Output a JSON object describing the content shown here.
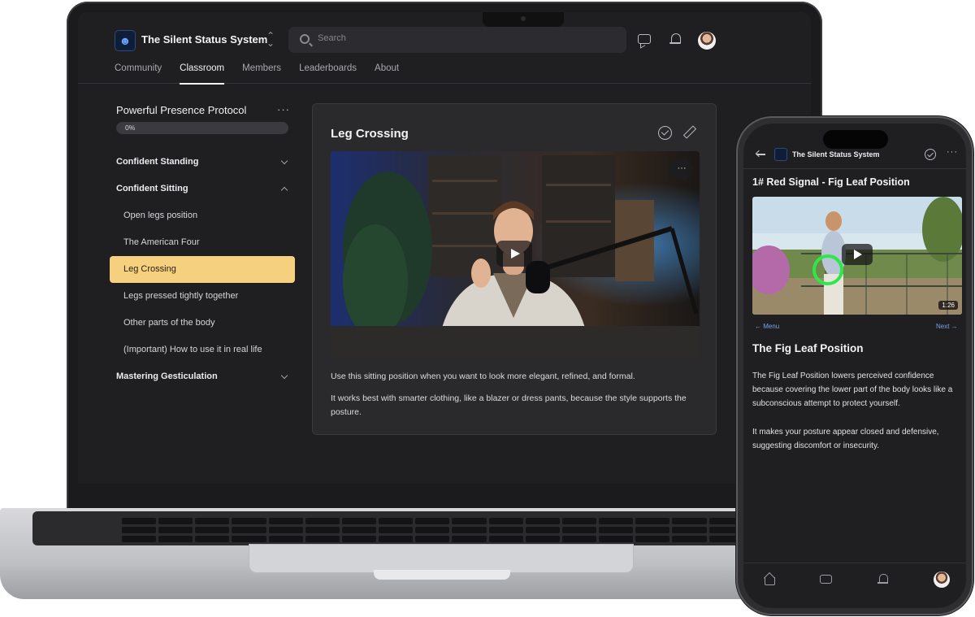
{
  "desktop": {
    "brand": {
      "name": "The Silent Status System"
    },
    "search": {
      "placeholder": "Search"
    },
    "nav_tabs": [
      "Community",
      "Classroom",
      "Members",
      "Leaderboards",
      "About"
    ],
    "active_tab": "Classroom",
    "course": {
      "title": "Powerful Presence Protocol",
      "menu": "···",
      "progress_label": "0%",
      "progress_fraction": 0.0
    },
    "sidebar": {
      "modules": [
        {
          "title": "Confident Standing",
          "expanded": false,
          "lessons": []
        },
        {
          "title": "Confident Sitting",
          "expanded": true,
          "lessons": [
            "Open legs position",
            "The American Four",
            "Leg Crossing",
            "Legs pressed tightly together",
            "Other parts of the body",
            "(Important) How to use it in real life"
          ]
        },
        {
          "title": "Mastering Gesticulation",
          "expanded": false,
          "lessons": []
        }
      ],
      "active_lesson": "Leg Crossing"
    },
    "lesson": {
      "title": "Leg Crossing",
      "video_menu": "···",
      "paragraphs": [
        "Use this sitting position when you want to look more elegant, refined, and formal.",
        "It works best with smarter clothing, like a blazer or dress pants, because the style supports the posture."
      ]
    }
  },
  "phone": {
    "brand": "The Silent Status System",
    "more": "···",
    "lesson_title": "1# Red Signal - Fig Leaf Position",
    "video_duration": "1:26",
    "nav_prev": "← Menu",
    "nav_next": "Next →",
    "heading": "The Fig Leaf Position",
    "paragraphs": [
      "The Fig Leaf Position lowers perceived confidence because covering the lower part of the body looks like a subconscious attempt to protect yourself.",
      "It makes your posture appear closed and defensive, suggesting discomfort or insecurity."
    ]
  },
  "colors": {
    "app_background": "#1f1f21",
    "active_lesson": "#f5d07e",
    "link_blue": "#7aa2e8",
    "highlight_ring": "#2ee84a"
  }
}
